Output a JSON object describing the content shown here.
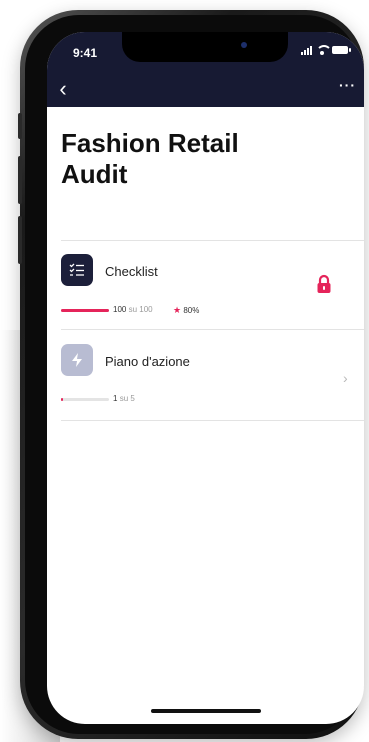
{
  "status_bar": {
    "time": "9:41"
  },
  "page": {
    "title": "Fashion Retail Audit"
  },
  "cards": [
    {
      "title": "Checklist",
      "progress_current": "100",
      "progress_total_text": "su 100",
      "progress_fraction": 1.0,
      "score": "80%",
      "locked": true
    },
    {
      "title": "Piano d'azione",
      "progress_current": "1",
      "progress_total_text": "su 5",
      "progress_fraction": 0.2
    }
  ],
  "colors": {
    "accent": "#e5245a",
    "navbar": "#171a33",
    "icon_primary": "#1c1f3a",
    "icon_secondary": "#b8bcd2"
  },
  "icons": {
    "back": "chevron-left-icon",
    "more": "more-horizontal-icon",
    "lock": "lock-icon",
    "next": "chevron-right-icon"
  }
}
